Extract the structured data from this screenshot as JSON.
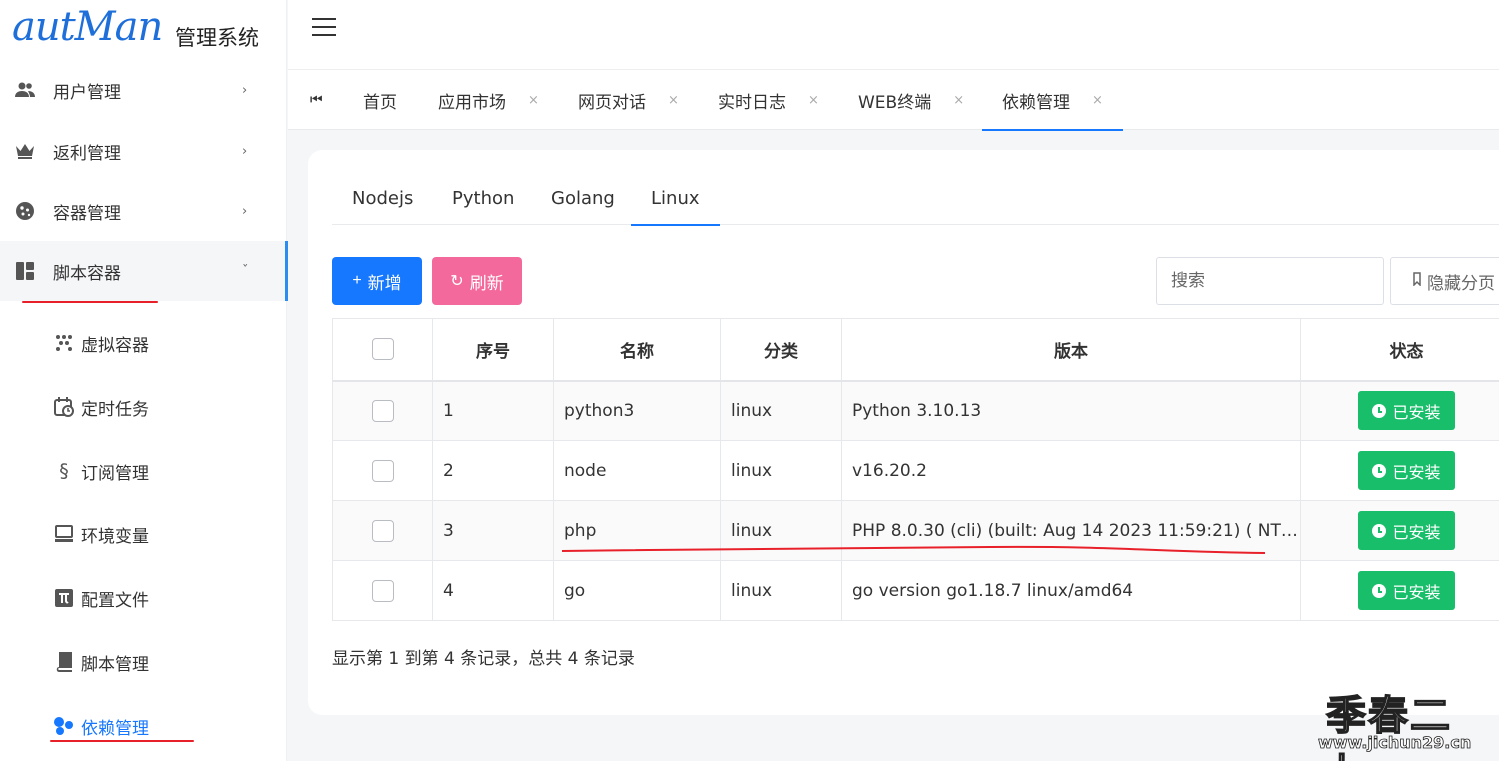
{
  "brand": {
    "logo_text": "autMan",
    "subtitle": "管理系统"
  },
  "sidebar": {
    "groups": [
      {
        "label": "用户管理",
        "icon": "users-icon"
      },
      {
        "label": "返利管理",
        "icon": "crown-icon"
      },
      {
        "label": "容器管理",
        "icon": "cookie-icon"
      },
      {
        "label": "脚本容器",
        "icon": "dashboard-icon",
        "expanded": true
      }
    ],
    "sub_items": [
      {
        "label": "虚拟容器",
        "icon": "dots-icon"
      },
      {
        "label": "定时任务",
        "icon": "calendar-clock-icon"
      },
      {
        "label": "订阅管理",
        "icon": "section-icon"
      },
      {
        "label": "环境变量",
        "icon": "monitor-icon"
      },
      {
        "label": "配置文件",
        "icon": "pi-icon"
      },
      {
        "label": "脚本管理",
        "icon": "book-icon"
      },
      {
        "label": "依赖管理",
        "icon": "cubes-icon",
        "active": true
      }
    ]
  },
  "tabs": {
    "first_icon": "⏮",
    "items": [
      {
        "label": "首页",
        "closable": false
      },
      {
        "label": "应用市场",
        "closable": true
      },
      {
        "label": "网页对话",
        "closable": true
      },
      {
        "label": "实时日志",
        "closable": true
      },
      {
        "label": "WEB终端",
        "closable": true
      },
      {
        "label": "依赖管理",
        "closable": true,
        "active": true
      }
    ],
    "close_glyph": "×"
  },
  "subtabs": [
    "Nodejs",
    "Python",
    "Golang",
    "Linux"
  ],
  "toolbar": {
    "add_label": "新增",
    "add_icon": "+",
    "refresh_label": "刷新",
    "refresh_icon": "↻",
    "search_placeholder": "搜索",
    "pager_label": "隐藏分页"
  },
  "table": {
    "headers": [
      "序号",
      "名称",
      "分类",
      "版本",
      "状态"
    ],
    "rows": [
      {
        "index": "1",
        "name": "python3",
        "category": "linux",
        "version": "Python 3.10.13",
        "status": "已安装"
      },
      {
        "index": "2",
        "name": "node",
        "category": "linux",
        "version": "v16.20.2",
        "status": "已安装"
      },
      {
        "index": "3",
        "name": "php",
        "category": "linux",
        "version": "PHP 8.0.30 (cli) (built: Aug 14 2023 11:59:21) ( NTS...",
        "status": "已安装"
      },
      {
        "index": "4",
        "name": "go",
        "category": "linux",
        "version": "go version go1.18.7 linux/amd64",
        "status": "已安装"
      }
    ],
    "summary": "显示第 1 到第 4 条记录，总共 4 条记录"
  },
  "watermark": {
    "title": "季春二九",
    "url": "www.jichun29.cn"
  },
  "colors": {
    "primary": "#1677ff",
    "refresh": "#f4699b",
    "success": "#19be6b",
    "annotation": "#e8202a"
  }
}
